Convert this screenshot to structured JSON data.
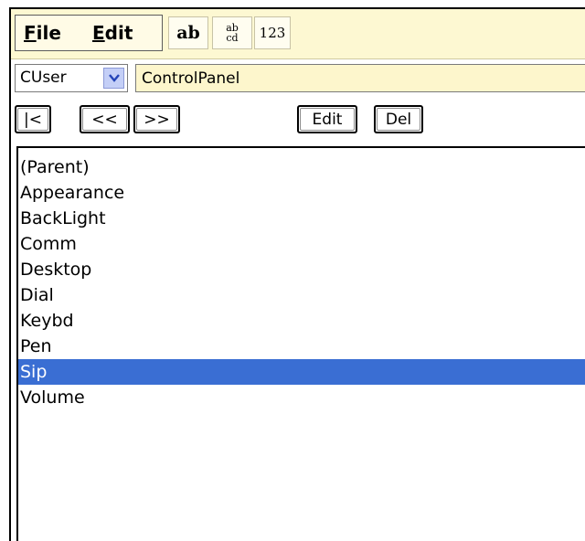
{
  "menu": {
    "file_label": "File",
    "edit_label": "Edit"
  },
  "toolbar": {
    "ab_label": "ab",
    "abcd_top": "ab",
    "abcd_bottom": "cd",
    "numbers_label": "123"
  },
  "address": {
    "root_key": "CUser",
    "path": "ControlPanel"
  },
  "nav": {
    "first_label": "|<",
    "prev_label": "<<",
    "next_label": ">>",
    "edit_label": "Edit",
    "delete_label": "Del"
  },
  "list": {
    "items": [
      "(Parent)",
      "Appearance",
      "BackLight",
      "Comm",
      "Desktop",
      "Dial",
      "Keybd",
      "Pen",
      "Sip",
      "Volume"
    ],
    "selected": "Sip"
  },
  "colors": {
    "selection": "#3a6ed3",
    "menubar": "#fdf8d2",
    "path_field": "#fdf6cc"
  }
}
